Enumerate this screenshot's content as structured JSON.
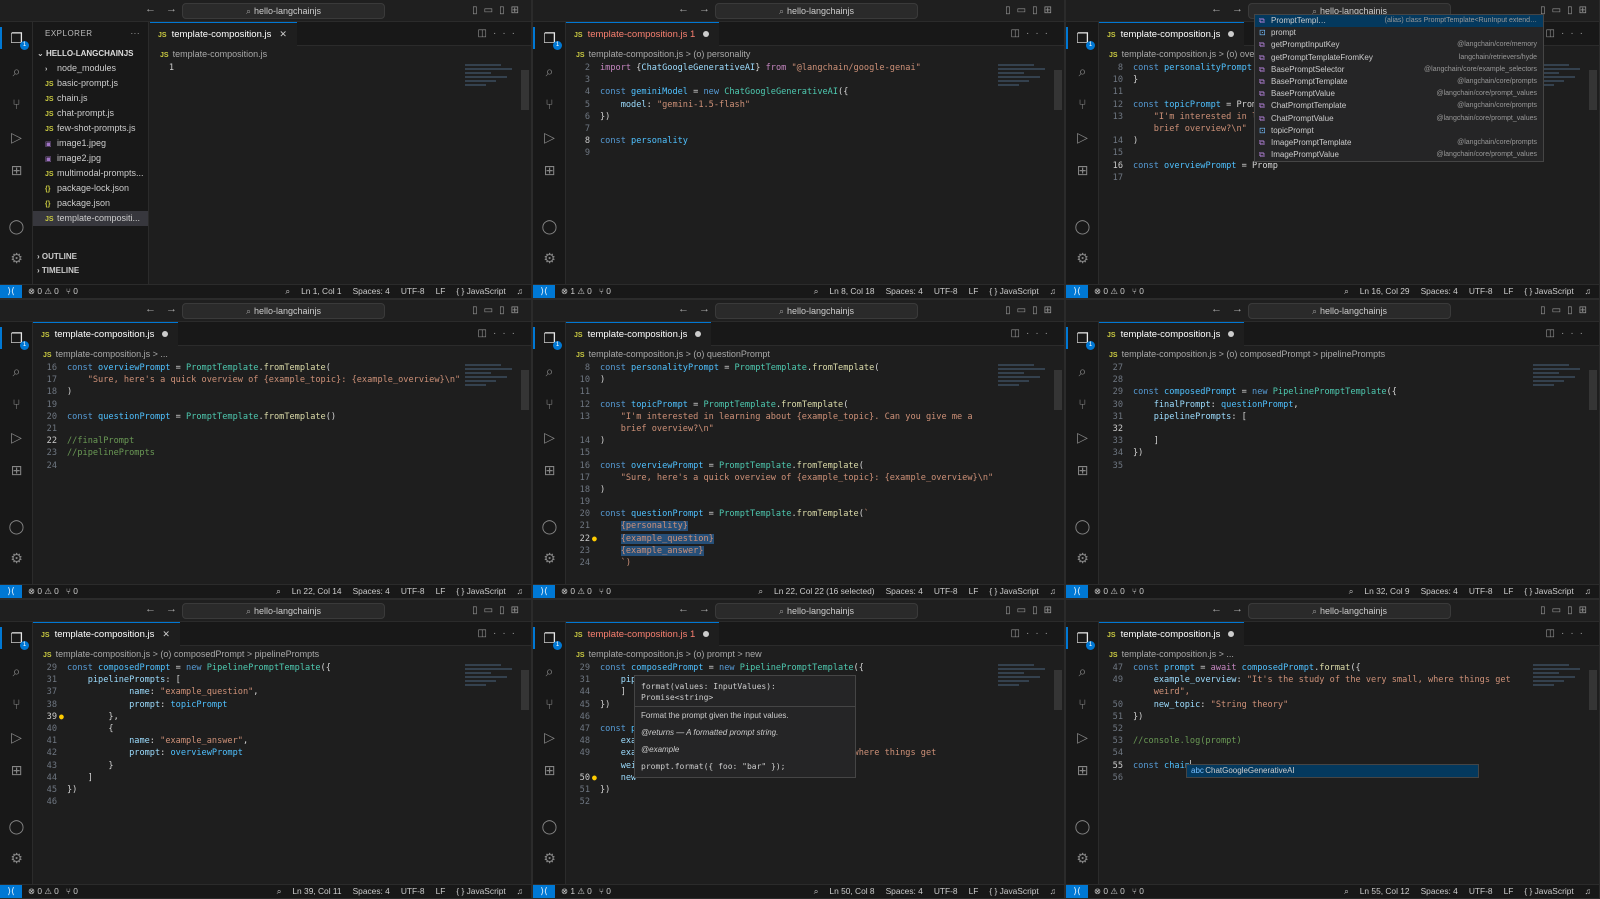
{
  "common": {
    "search_text": "hello-langchainjs",
    "nav_back": "←",
    "nav_forward": "→",
    "spaces": "Spaces: 4",
    "encoding": "UTF-8",
    "eol": "LF",
    "language": "{ } JavaScript",
    "ports": "0",
    "accent_color": "#0078d4"
  },
  "p1": {
    "explorer_title": "EXPLORER",
    "root": "HELLO-LANGCHAINJS",
    "files": [
      "node_modules",
      "basic-prompt.js",
      "chain.js",
      "chat-prompt.js",
      "few-shot-prompts.js",
      "image1.jpeg",
      "image2.jpg",
      "multimodal-prompts...",
      "package-lock.json",
      "package.json",
      "template-compositi..."
    ],
    "outline": "OUTLINE",
    "timeline": "TIMELINE",
    "tab": "template-composition.js",
    "breadcrumb": "template-composition.js",
    "status": {
      "problems": "0 ⚠ 0",
      "pos": "Ln 1, Col 1"
    }
  },
  "p2": {
    "tab": "template-composition.js 1",
    "breadcrumb": "template-composition.js > (o) personality",
    "status": {
      "problems": "1 ⚠ 0",
      "pos": "Ln 8, Col 18"
    }
  },
  "p3": {
    "tab": "template-composition.js",
    "breadcrumb": "template-composition.js > (o) overvie",
    "status": {
      "problems": "0 ⚠ 0",
      "pos": "Ln 16, Col 29"
    },
    "suggestions": [
      {
        "name": "PromptTempl…",
        "src": "(alias) class PromptTemplate<RunInput extend…",
        "kind": "class"
      },
      {
        "name": "prompt",
        "src": "",
        "kind": "var"
      },
      {
        "name": "getPromptInputKey",
        "src": "@langchain/core/memory",
        "kind": "class"
      },
      {
        "name": "getPromptTemplateFromKey",
        "src": "langchain/retrievers/hyde",
        "kind": "class"
      },
      {
        "name": "BasePromptSelector",
        "src": "@langchain/core/example_selectors",
        "kind": "class"
      },
      {
        "name": "BasePromptTemplate",
        "src": "@langchain/core/prompts",
        "kind": "class"
      },
      {
        "name": "BasePromptValue",
        "src": "@langchain/core/prompt_values",
        "kind": "class"
      },
      {
        "name": "ChatPromptTemplate",
        "src": "@langchain/core/prompts",
        "kind": "class"
      },
      {
        "name": "ChatPromptValue",
        "src": "@langchain/core/prompt_values",
        "kind": "class"
      },
      {
        "name": "topicPrompt",
        "src": "",
        "kind": "var"
      },
      {
        "name": "ImagePromptTemplate",
        "src": "@langchain/core/prompts",
        "kind": "class"
      },
      {
        "name": "ImagePromptValue",
        "src": "@langchain/core/prompt_values",
        "kind": "class"
      }
    ]
  },
  "p4": {
    "tab": "template-composition.js",
    "breadcrumb": "template-composition.js > ...",
    "status": {
      "problems": "0 ⚠ 0",
      "pos": "Ln 22, Col 14"
    }
  },
  "p5": {
    "tab": "template-composition.js",
    "breadcrumb": "template-composition.js > (o) questionPrompt",
    "status": {
      "problems": "0 ⚠ 0",
      "pos": "Ln 22, Col 22 (16 selected)"
    }
  },
  "p6": {
    "tab": "template-composition.js",
    "breadcrumb": "template-composition.js > (o) composedPrompt > pipelinePrompts",
    "status": {
      "problems": "0 ⚠ 0",
      "pos": "Ln 32, Col 9"
    }
  },
  "p7": {
    "tab": "template-composition.js",
    "breadcrumb": "template-composition.js > (o) composedPrompt > pipelinePrompts",
    "status": {
      "problems": "0 ⚠ 0",
      "pos": "Ln 39, Col 11"
    }
  },
  "p8": {
    "tab": "template-composition.js 1",
    "breadcrumb": "template-composition.js > (o) prompt > new",
    "status": {
      "problems": "1 ⚠ 0",
      "pos": "Ln 50, Col 8"
    },
    "hover": {
      "sig": "format(values: InputValues): Promise<string>",
      "desc": "Format the prompt given the input values.",
      "returns": "@returns — A formatted prompt string.",
      "example": "@example",
      "example_code": "prompt.format({ foo: \"bar\" });"
    }
  },
  "p9": {
    "tab": "template-composition.js",
    "breadcrumb": "template-composition.js > ...",
    "status": {
      "problems": "0 ⚠ 0",
      "pos": "Ln 55, Col 12"
    },
    "suggestion": "ChatGoogleGenerativeAI"
  }
}
